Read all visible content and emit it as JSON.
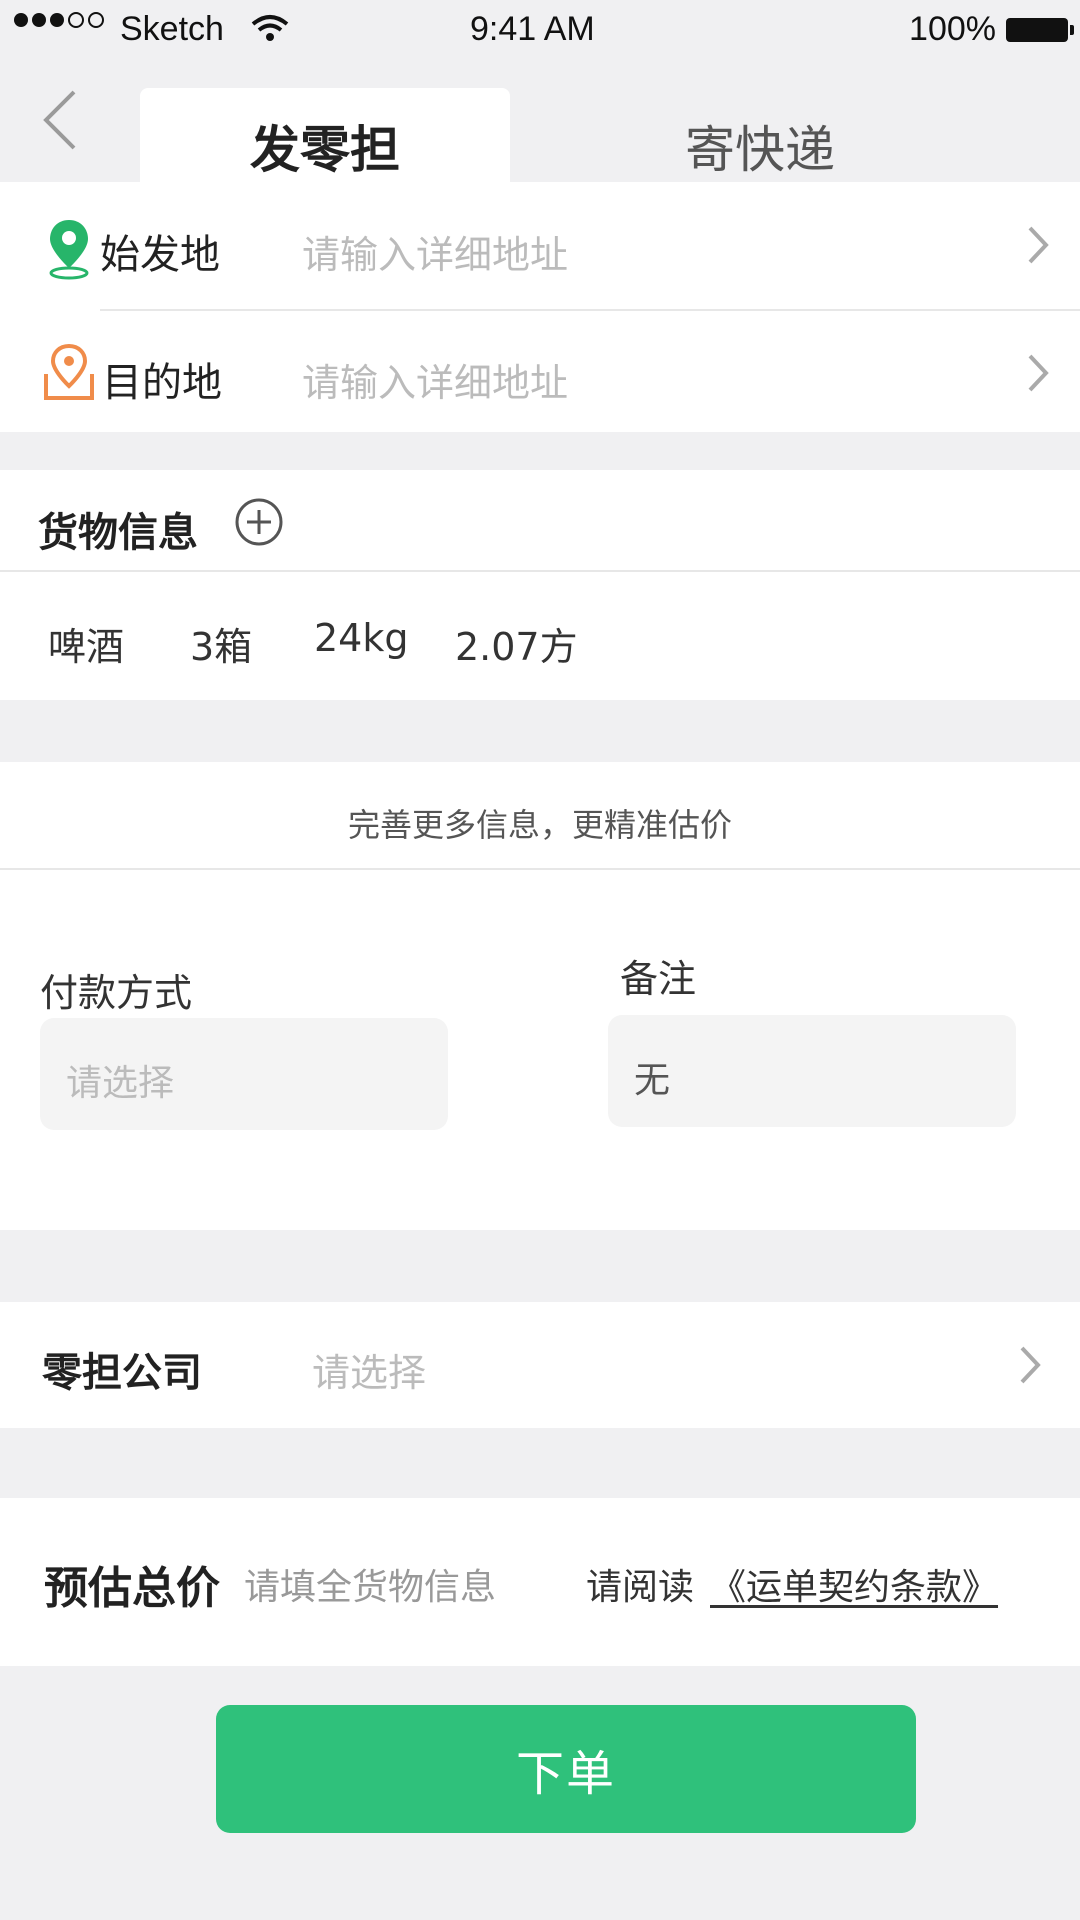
{
  "status_bar": {
    "carrier": "Sketch",
    "time": "9:41 AM",
    "battery": "100%"
  },
  "tabs": [
    {
      "label": "发零担",
      "active": true
    },
    {
      "label": "寄快递",
      "active": false
    }
  ],
  "address": {
    "origin": {
      "label": "始发地",
      "placeholder": "请输入详细地址",
      "icon": "green-location-pin-icon"
    },
    "destination": {
      "label": "目的地",
      "placeholder": "请输入详细地址",
      "icon": "orange-location-box-icon"
    }
  },
  "cargo": {
    "title": "货物信息",
    "item": {
      "name": "啤酒",
      "quantity": "3箱",
      "weight": "24kg",
      "volume": "2.07方"
    }
  },
  "more_info": {
    "hint": "完善更多信息，更精准估价",
    "payment": {
      "label": "付款方式",
      "placeholder": "请选择"
    },
    "remark": {
      "label": "备注",
      "value": "无"
    }
  },
  "company": {
    "label": "零担公司",
    "placeholder": "请选择"
  },
  "estimate": {
    "label": "预估总价",
    "hint": "请填全货物信息",
    "terms_prefix": "请阅读",
    "terms_link": "《运单契约条款》"
  },
  "submit_label": "下单",
  "colors": {
    "accent_green": "#2fc17b",
    "pin_green": "#27b56a",
    "pin_orange": "#f08c4a"
  }
}
